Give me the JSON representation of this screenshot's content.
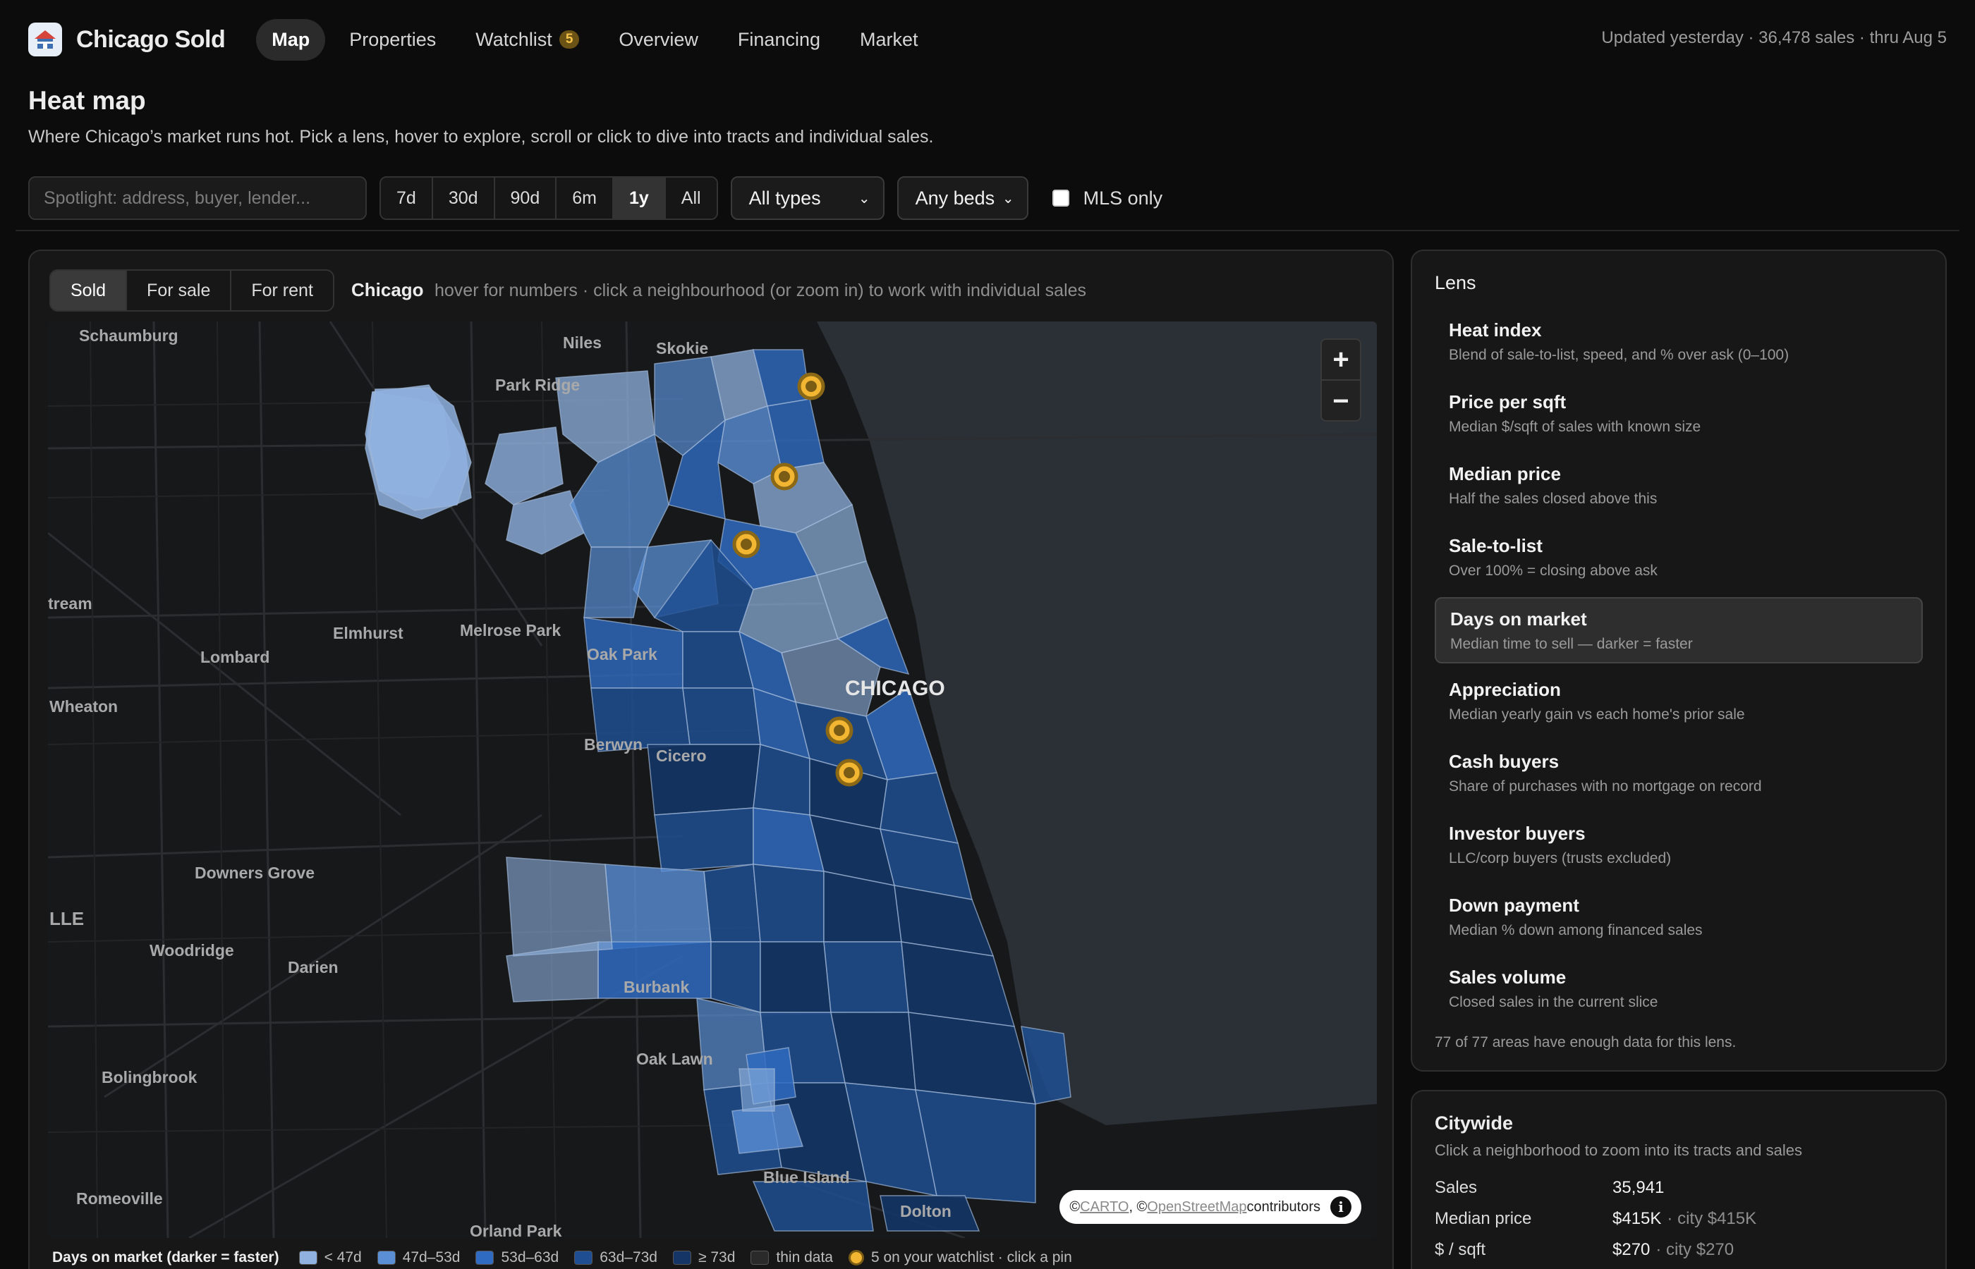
{
  "nav": {
    "brand": "Chicago Sold",
    "links": [
      "Map",
      "Properties",
      "Watchlist",
      "Overview",
      "Financing",
      "Market"
    ],
    "watchlist_count": "5",
    "status": "Updated yesterday · 36,478 sales · thru Aug 5"
  },
  "page": {
    "title": "Heat map",
    "subtitle": "Where Chicago’s market runs hot. Pick a lens, hover to explore, scroll or click to dive into tracts and individual sales."
  },
  "filters": {
    "search_placeholder": "Spotlight: address, buyer, lender...",
    "ranges": [
      "7d",
      "30d",
      "90d",
      "6m",
      "1y",
      "All"
    ],
    "active_range": "1y",
    "type_select": "All types",
    "beds_select": "Any beds",
    "mls_label": "MLS only"
  },
  "map": {
    "modes": [
      "Sold",
      "For sale",
      "For rent"
    ],
    "active_mode": "Sold",
    "city": "Chicago",
    "hint": "hover for numbers · click a neighbourhood (or zoom in) to work with individual sales",
    "zoom_in": "+",
    "zoom_out": "−",
    "attribution": {
      "prefix": "© ",
      "carto": "CARTO",
      "sep": ", © ",
      "osm": "OpenStreetMap",
      "suffix": " contributors",
      "info": "i"
    },
    "labels": {
      "schaumburg": "Schaumburg",
      "niles": "Niles",
      "skokie": "Skokie",
      "park_ridge": "Park Ridge",
      "stream": "tream",
      "elmhurst": "Elmhurst",
      "melrose_park": "Melrose Park",
      "lombard": "Lombard",
      "oak_park": "Oak Park",
      "chicago": "CHICAGO",
      "wheaton": "Wheaton",
      "berwyn": "Berwyn",
      "cicero": "Cicero",
      "downers_grove": "Downers Grove",
      "lle": "LLE",
      "woodridge": "Woodridge",
      "darien": "Darien",
      "burbank": "Burbank",
      "oak_lawn": "Oak Lawn",
      "bolingbrook": "Bolingbrook",
      "blue_island": "Blue Island",
      "romeoville": "Romeoville",
      "dolton": "Dolton",
      "orland_park": "Orland Park"
    },
    "watchlist_pins": 5
  },
  "legend": {
    "title": "Days on market (darker = faster)",
    "items": [
      {
        "label": "< 47d",
        "color": "#8fb2e0"
      },
      {
        "label": "47d–53d",
        "color": "#5a8fd6"
      },
      {
        "label": "53d–63d",
        "color": "#2f6bc0"
      },
      {
        "label": "63d–73d",
        "color": "#1f4f92"
      },
      {
        "label": "≥ 73d",
        "color": "#143566"
      },
      {
        "label": "thin data",
        "color": "#2a2a2a"
      }
    ],
    "watchlist_label": "5 on your watchlist · click a pin"
  },
  "lens": {
    "title": "Lens",
    "items": [
      {
        "name": "Heat index",
        "desc": "Blend of sale-to-list, speed, and % over ask (0–100)"
      },
      {
        "name": "Price per sqft",
        "desc": "Median $/sqft of sales with known size"
      },
      {
        "name": "Median price",
        "desc": "Half the sales closed above this"
      },
      {
        "name": "Sale-to-list",
        "desc": "Over 100% = closing above ask"
      },
      {
        "name": "Days on market",
        "desc": "Median time to sell — darker = faster"
      },
      {
        "name": "Appreciation",
        "desc": "Median yearly gain vs each home's prior sale"
      },
      {
        "name": "Cash buyers",
        "desc": "Share of purchases with no mortgage on record"
      },
      {
        "name": "Investor buyers",
        "desc": "LLC/corp buyers (trusts excluded)"
      },
      {
        "name": "Down payment",
        "desc": "Median % down among financed sales"
      },
      {
        "name": "Sales volume",
        "desc": "Closed sales in the current slice"
      }
    ],
    "active": "Days on market",
    "footer": "77 of 77 areas have enough data for this lens."
  },
  "citywide": {
    "title": "Citywide",
    "subtitle": "Click a neighborhood to zoom into its tracts and sales",
    "stats": [
      {
        "label": "Sales",
        "value": "35,941",
        "city": ""
      },
      {
        "label": "Median price",
        "value": "$415K",
        "city": "· city $415K"
      },
      {
        "label": "$ / sqft",
        "value": "$270",
        "city": "· city $270"
      }
    ]
  },
  "colors": {
    "accent": "#f2b632",
    "lake": "#2b2f36",
    "land": "#17181a"
  }
}
